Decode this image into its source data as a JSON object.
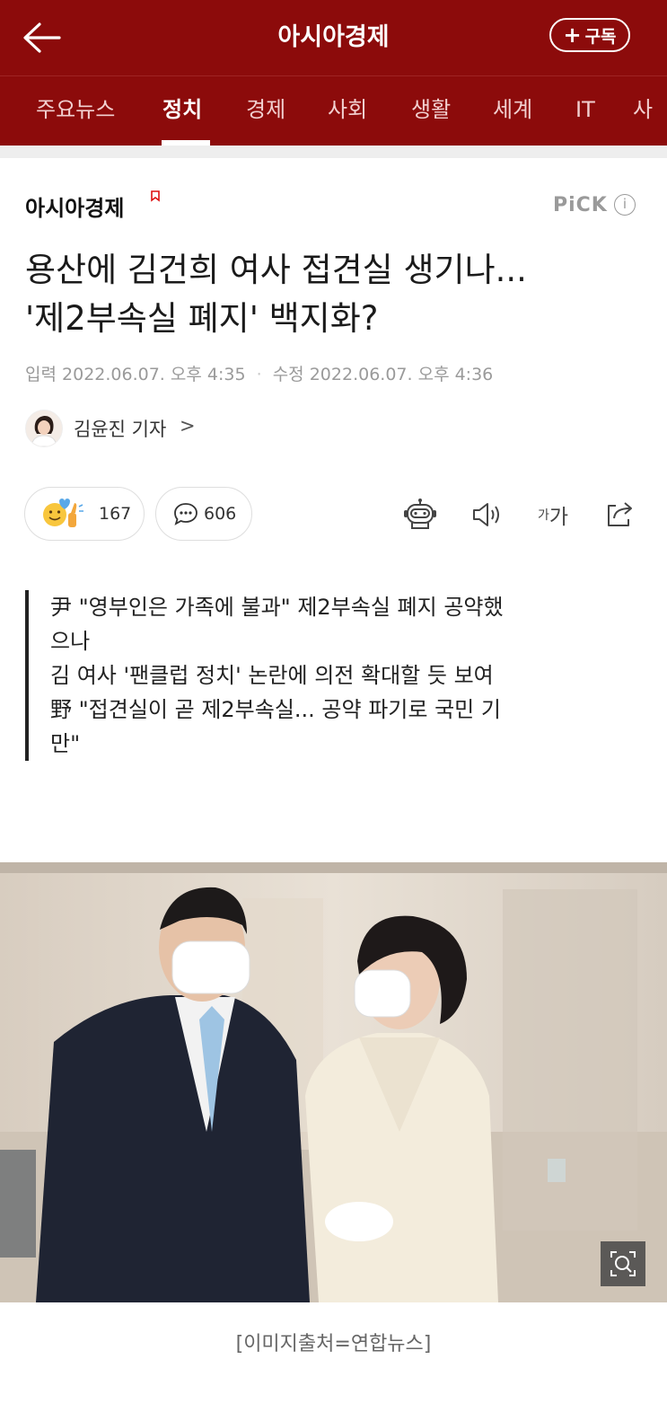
{
  "header": {
    "title": "아시아경제",
    "subscribe_label": "구독"
  },
  "tabs": [
    {
      "label": "주요뉴스",
      "active": false
    },
    {
      "label": "정치",
      "active": true
    },
    {
      "label": "경제",
      "active": false
    },
    {
      "label": "사회",
      "active": false
    },
    {
      "label": "생활",
      "active": false
    },
    {
      "label": "세계",
      "active": false
    },
    {
      "label": "IT",
      "active": false
    },
    {
      "label": "사",
      "active": false
    }
  ],
  "article": {
    "press_name": "아시아경제",
    "pick_label": "PiCK",
    "pick_info": "i",
    "headline_line1": "용산에 김건희 여사 접견실 생기나...",
    "headline_line2": "'제2부속실 폐지' 백지화?",
    "input_label": "입력",
    "input_time": "2022.06.07. 오후 4:35",
    "modified_label": "수정",
    "modified_time": "2022.06.07. 오후 4:36",
    "author": "김윤진 기자",
    "author_chevron": ">",
    "reaction_count": "167",
    "comment_count": "606",
    "font_size_small": "가",
    "font_size_big": "가",
    "summary": [
      "尹 \"영부인은 가족에 불과\" 제2부속실 폐지 공약했",
      "으나",
      "김 여사 '팬클럽 정치' 논란에 의전 확대할 듯 보여",
      "野 \"접견실이 곧 제2부속실... 공약 파기로 국민 기",
      "만\""
    ],
    "image_caption": "[이미지출처=연합뉴스]"
  },
  "colors": {
    "brand": "#8c0b0b",
    "tab_inactive": "#f2d0d0",
    "muted": "#9a9a9a"
  },
  "icons": {
    "back": "arrow-left-icon",
    "reaction": "smile-thumbs-icon",
    "comment": "speech-bubble-icon",
    "robot": "robot-icon",
    "speaker": "speaker-icon",
    "font_size": "font-size-icon",
    "share": "share-icon",
    "zoom": "zoom-icon"
  }
}
